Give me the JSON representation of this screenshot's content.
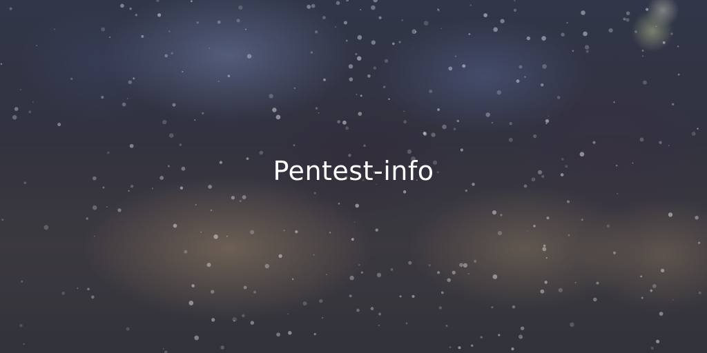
{
  "banner": {
    "title": "Pentest-info"
  }
}
